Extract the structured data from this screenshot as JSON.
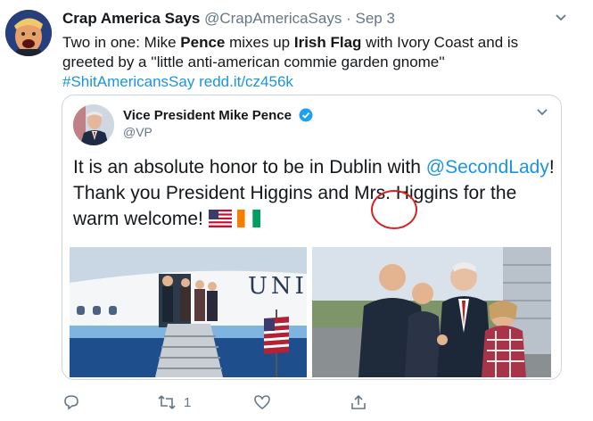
{
  "tweet": {
    "author_name": "Crap America Says",
    "handle": "@CrapAmericaSays",
    "separator": "·",
    "date": "Sep 3",
    "text_part1": "Two in one: Mike ",
    "text_bold1": "Pence",
    "text_part2": " mixes up ",
    "text_bold2": "Irish Flag",
    "text_part3": " with Ivory Coast and is greeted by a ''little anti-american commie garden gnome''",
    "hashtag": "#ShitAmericansSay",
    "link": "redd.it/cz456k"
  },
  "quoted_tweet": {
    "author_name": "Vice President Mike Pence",
    "handle": "@VP",
    "text_part1": "It is an absolute honor to be in Dublin with ",
    "mention": "@SecondLady",
    "text_part2": "! Thank you President Higgins and Mrs. Higgins  for the warm welcome! "
  },
  "actions": {
    "retweet_count": "1"
  },
  "icons": [
    "chevron-down-icon",
    "verified-icon",
    "us-flag-icon",
    "ivory-coast-flag-icon",
    "reply-icon",
    "retweet-icon",
    "like-icon",
    "share-icon"
  ],
  "colors": {
    "link": "#1b95e0",
    "muted": "#657786",
    "verified": "#1da1f2",
    "highlight_circle": "#d72222"
  }
}
